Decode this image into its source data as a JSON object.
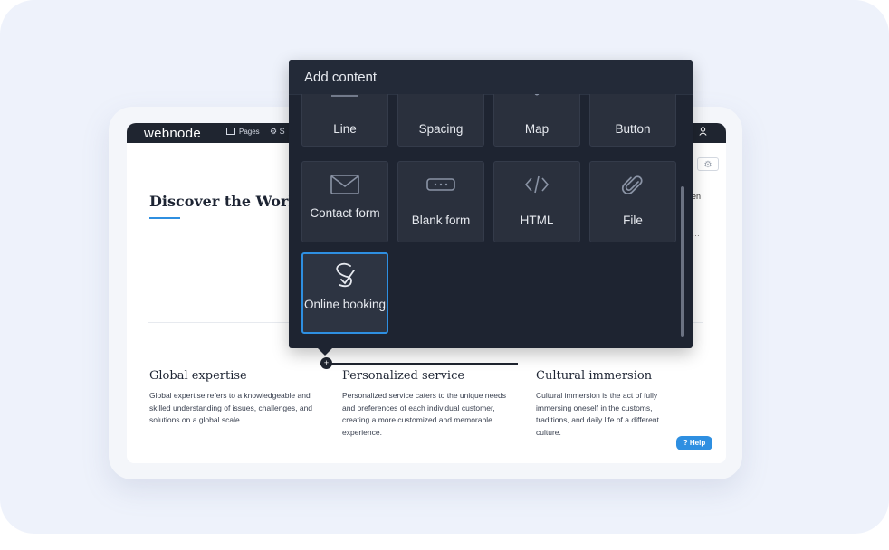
{
  "app": {
    "logo": "webnode",
    "nav_pages": "Pages",
    "nav_settings_short": "S"
  },
  "page": {
    "heading": "Discover the World w",
    "edge_text_1": "en",
    "edge_text_2": "…",
    "features": [
      {
        "title": "Global expertise",
        "desc": "Global expertise refers to a knowledgeable and skilled understanding of issues, challenges, and solutions on a global scale."
      },
      {
        "title": "Personalized service",
        "desc": "Personalized service caters to the unique needs and preferences of each individual customer, creating a more customized and memorable experience."
      },
      {
        "title": "Cultural immersion",
        "desc": "Cultural immersion is the act of fully immersing oneself in the customs, traditions, and daily life of a different culture."
      }
    ],
    "help_label": "Help"
  },
  "add_content": {
    "title": "Add content",
    "tiles": [
      {
        "label": "Line",
        "icon": "line-icon"
      },
      {
        "label": "Spacing",
        "icon": "spacing-icon"
      },
      {
        "label": "Map",
        "icon": "map-icon"
      },
      {
        "label": "Button",
        "icon": "button-icon"
      },
      {
        "label": "Contact form",
        "icon": "envelope-icon"
      },
      {
        "label": "Blank form",
        "icon": "form-field-icon"
      },
      {
        "label": "HTML",
        "icon": "code-icon"
      },
      {
        "label": "File",
        "icon": "paperclip-icon"
      },
      {
        "label": "Online booking",
        "icon": "booking-icon"
      }
    ]
  },
  "colors": {
    "accent": "#2e8fe1",
    "panel_bg": "#1e2431",
    "tile_bg": "#2a303d",
    "topbar_bg": "#1f2530"
  }
}
